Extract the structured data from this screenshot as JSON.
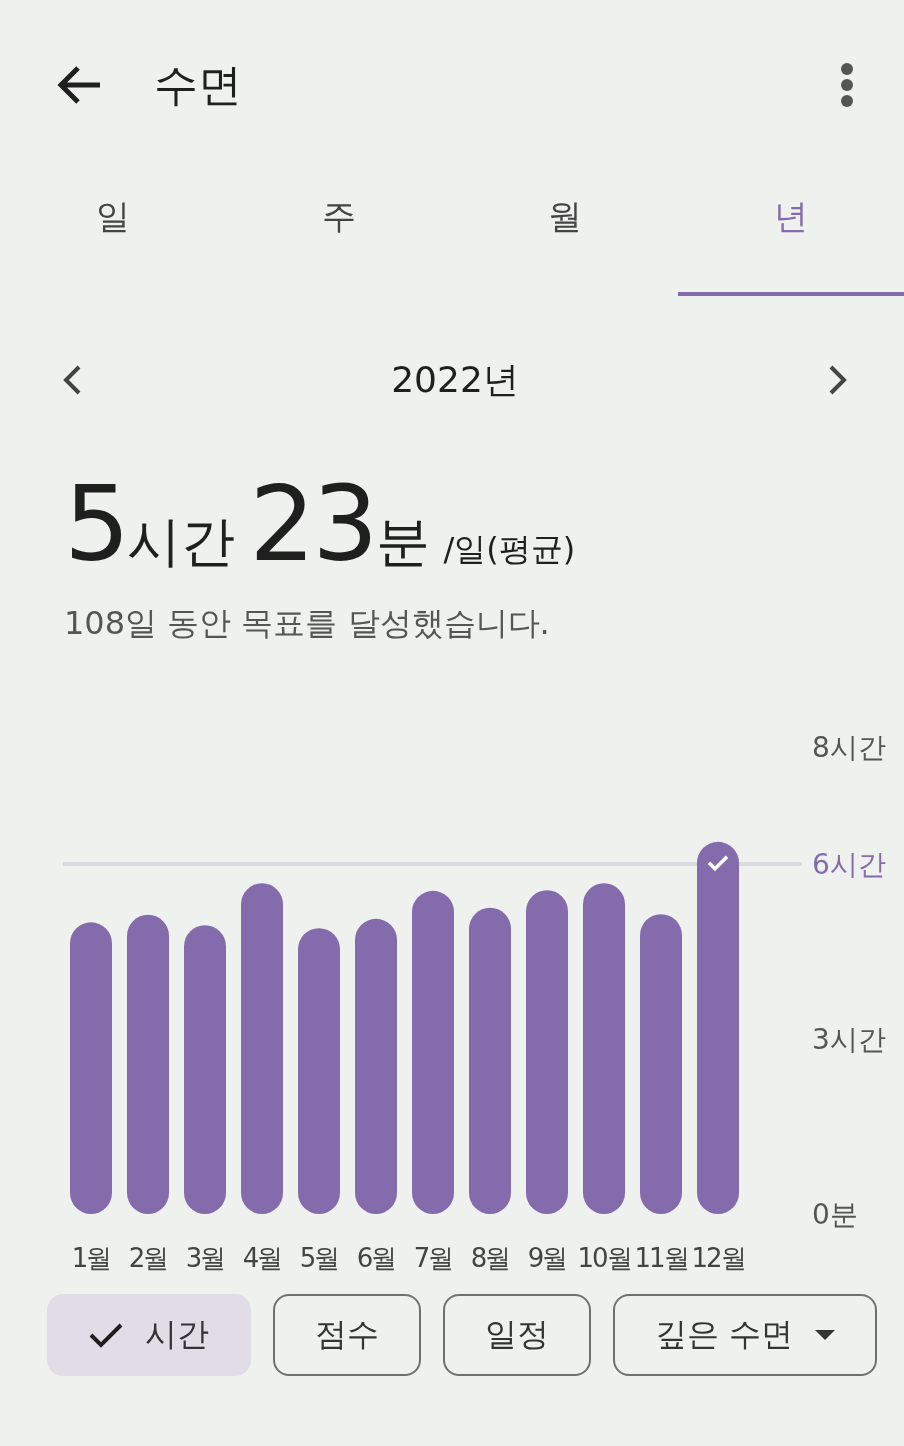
{
  "header": {
    "title": "수면"
  },
  "tabs": [
    {
      "label": "일",
      "selected": false
    },
    {
      "label": "주",
      "selected": false
    },
    {
      "label": "월",
      "selected": false
    },
    {
      "label": "년",
      "selected": true
    }
  ],
  "period": {
    "label": "2022년"
  },
  "summary": {
    "segments": [
      {
        "text": "5",
        "kind": "number"
      },
      {
        "text": "시간",
        "kind": "unit"
      },
      {
        "text": "23",
        "kind": "number"
      },
      {
        "text": "분",
        "kind": "unit"
      },
      {
        "text": "/일(평균)",
        "kind": "suffix"
      }
    ],
    "note": "108일 동안 목표를 달성했습니다."
  },
  "chart_data": {
    "type": "bar",
    "categories": [
      "1월",
      "2월",
      "3월",
      "4월",
      "5월",
      "6월",
      "7월",
      "8월",
      "9월",
      "10월",
      "11월",
      "12월"
    ],
    "series": [
      {
        "color": "#846bab",
        "values": [
          5.0,
          5.13,
          4.95,
          5.67,
          4.9,
          5.06,
          5.54,
          5.25,
          5.55,
          5.67,
          5.14,
          6.38
        ]
      }
    ],
    "ylim": [
      0,
      8
    ],
    "yticks": [
      {
        "value": 0,
        "label": "0분"
      },
      {
        "value": 3,
        "label": "3시간"
      },
      {
        "value": 8,
        "label": "8시간"
      }
    ],
    "ref_lines": [
      {
        "axis": "y",
        "value": 6,
        "label": "6시간"
      }
    ]
  },
  "chips": [
    {
      "label": "시간",
      "kind": "toggle",
      "selected": true
    },
    {
      "label": "점수",
      "kind": "toggle",
      "selected": false
    },
    {
      "label": "일정",
      "kind": "toggle",
      "selected": false
    },
    {
      "label": "깊은 수면",
      "kind": "dropdown",
      "selected": false
    }
  ]
}
